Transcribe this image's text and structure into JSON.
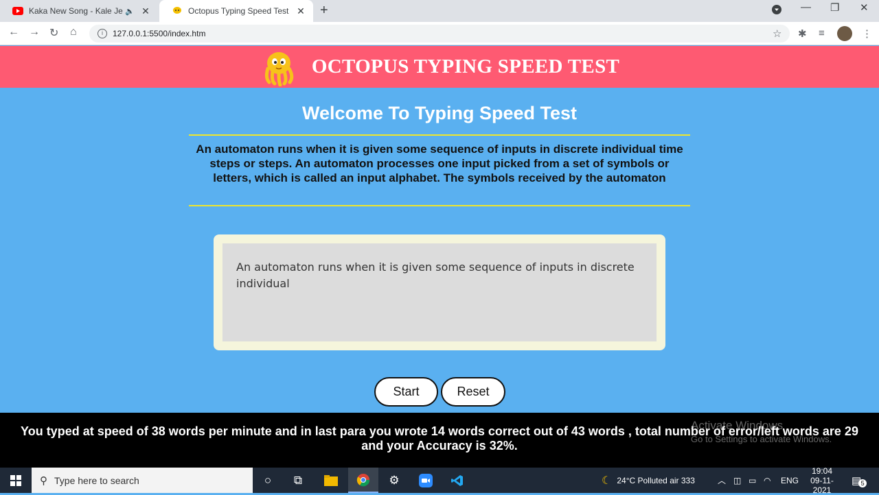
{
  "browser": {
    "tabs": [
      {
        "title": "Kaka New Song - Kale Je Lib",
        "active": false
      },
      {
        "title": "Octopus Typing Speed Test",
        "active": true
      }
    ],
    "url": "127.0.0.1:5500/index.htm"
  },
  "page": {
    "header_title": "OCTOPUS TYPING SPEED TEST",
    "welcome": "Welcome To Typing Speed Test",
    "paragraph": "An automaton runs when it is given some sequence of inputs in discrete individual time steps or steps. An automaton processes one input picked from a set of symbols or letters, which is called an input alphabet. The symbols received by the automaton",
    "typed_text": "An automaton runs when it is given some sequence of inputs in discrete individual",
    "start_label": "Start",
    "reset_label": "Reset",
    "result": "You typed at speed of 38 words per minute and in last para you wrote 14 words correct out of 43 words , total number of error/left words are 29 and your Accuracy is 32%."
  },
  "watermark": {
    "line1": "Activate Windows",
    "line2": "Go to Settings to activate Windows."
  },
  "taskbar": {
    "search_placeholder": "Type here to search",
    "weather": "24°C  Polluted air 333",
    "lang": "ENG",
    "time": "19:04",
    "date": "09-11-2021",
    "notifications": "5"
  },
  "colors": {
    "header": "#fe5a72",
    "page_bg": "#5ab0f0",
    "divider": "#f0e62a"
  }
}
